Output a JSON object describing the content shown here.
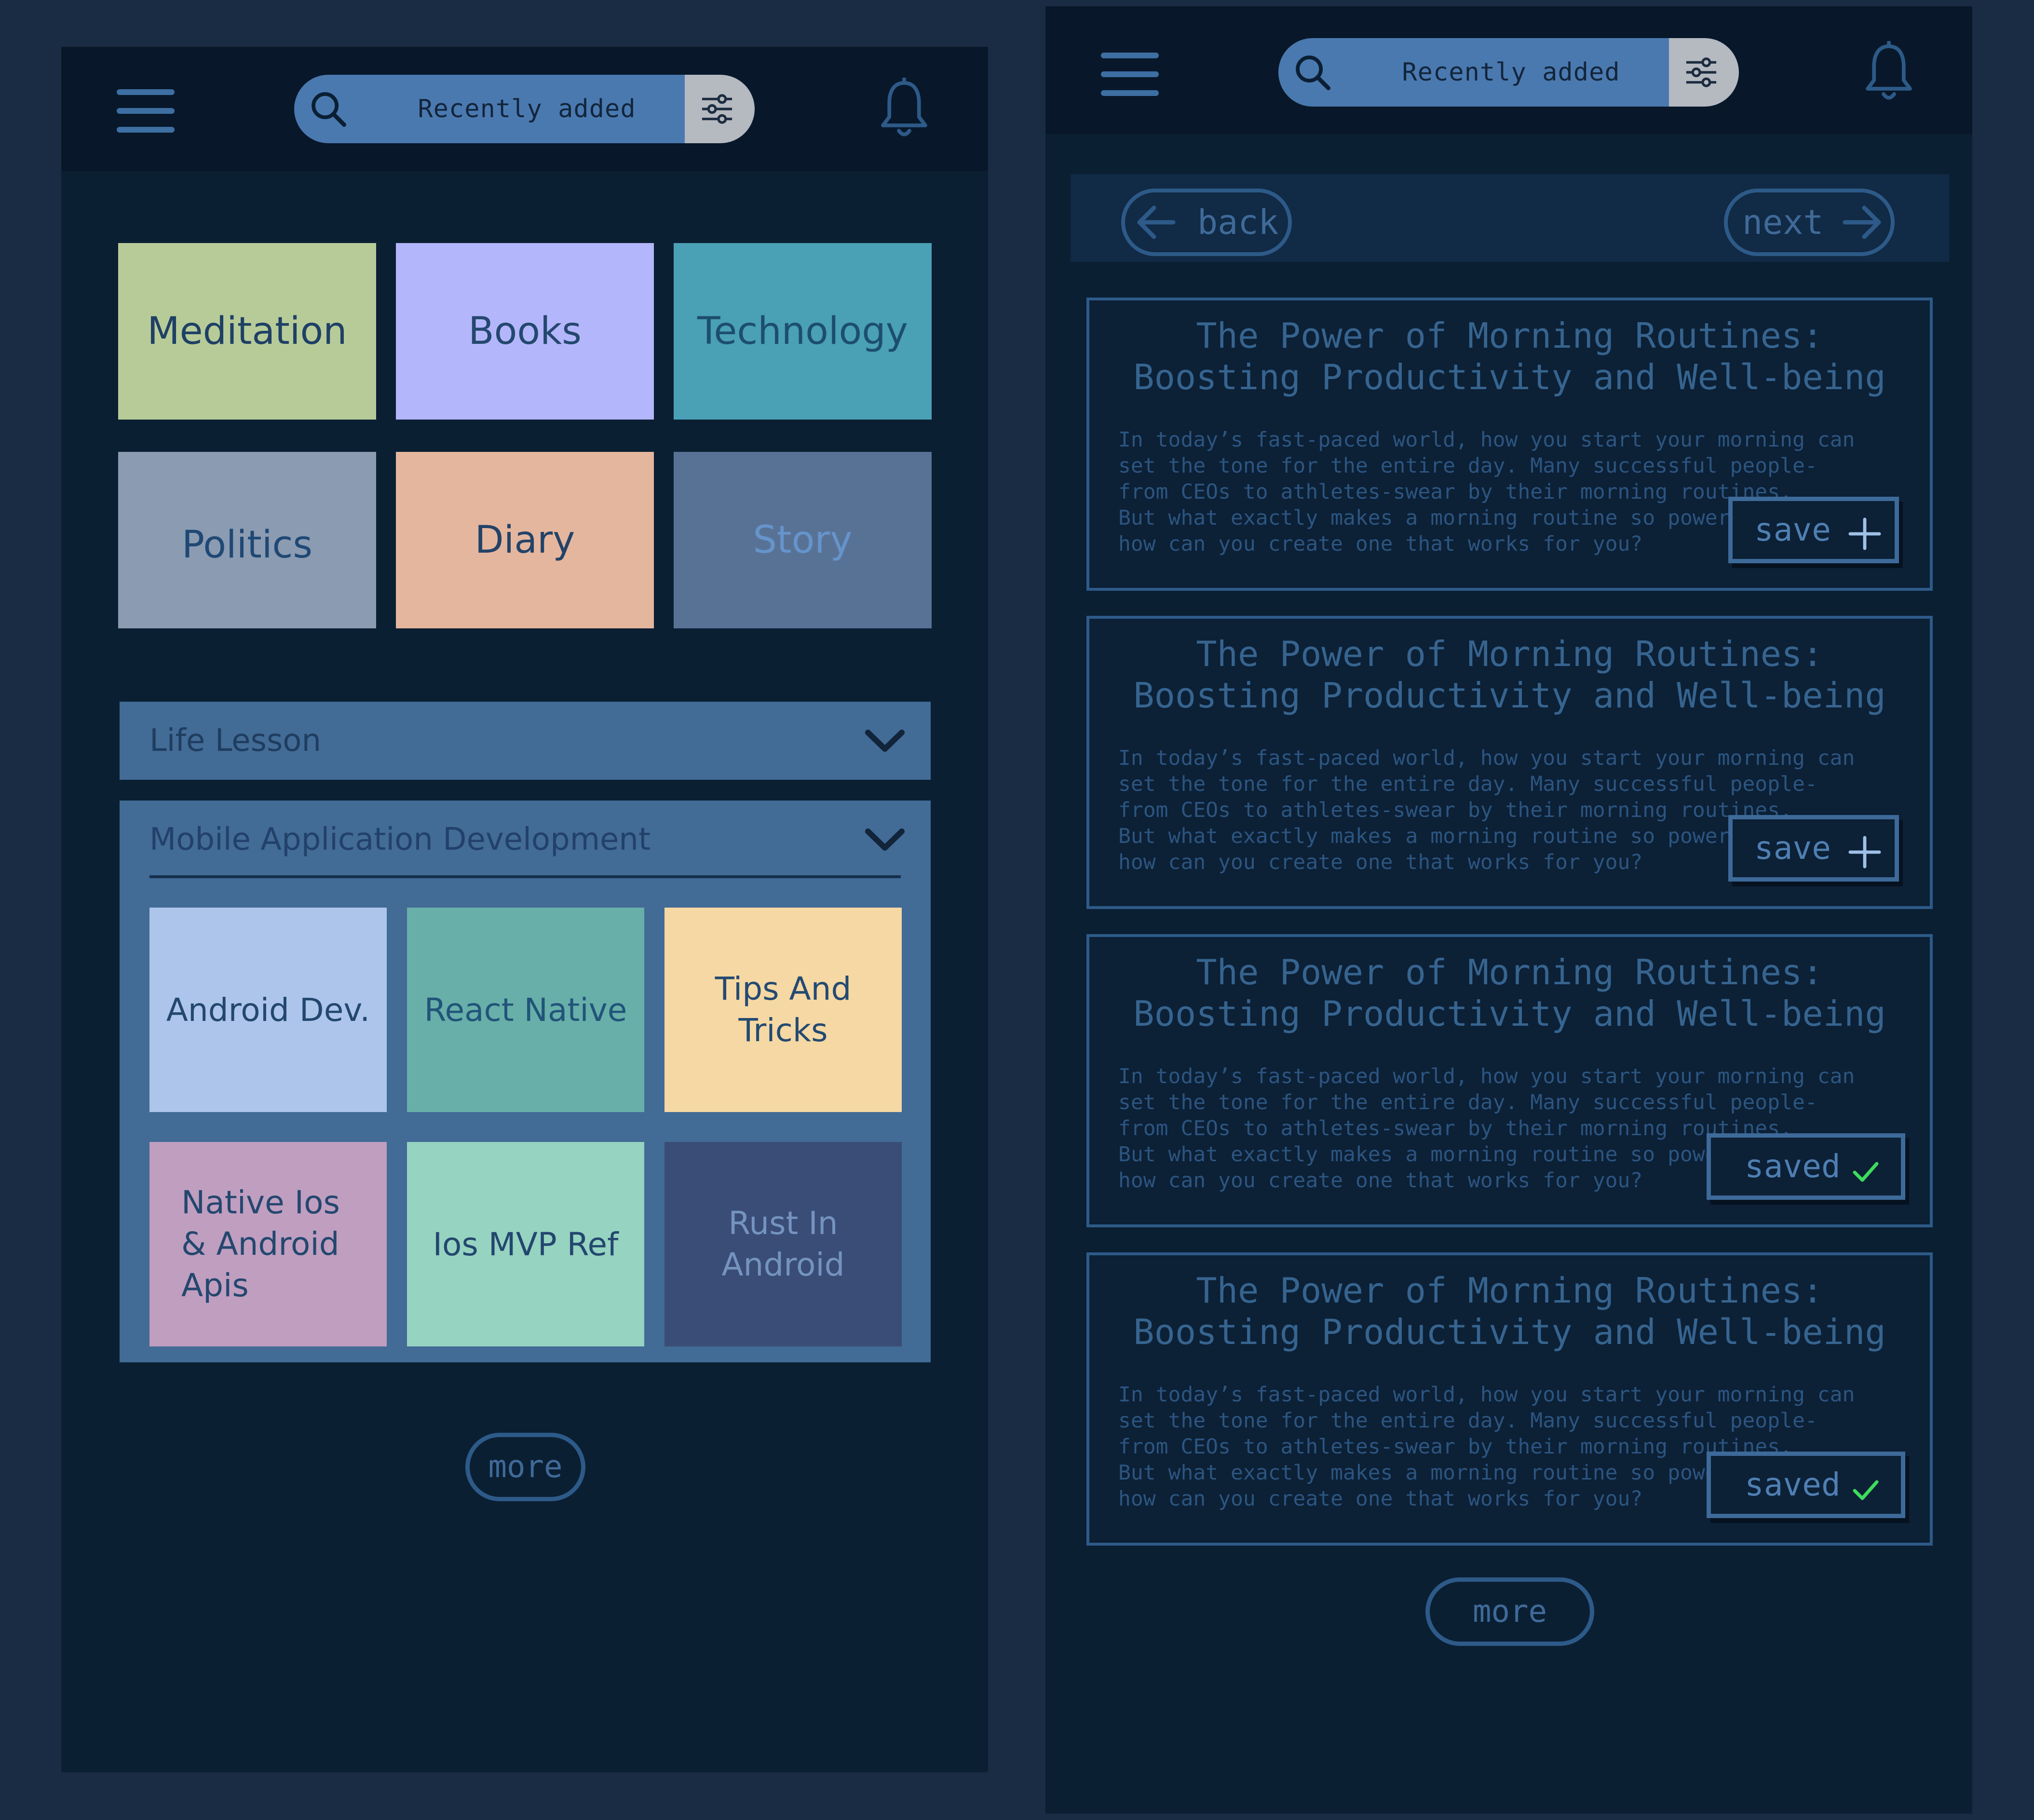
{
  "search": {
    "text": "Recently added"
  },
  "left": {
    "categories": [
      "Meditation",
      "Books",
      "Technology",
      "Politics",
      "Diary",
      "Story"
    ],
    "accordion1": {
      "title": "Life Lesson"
    },
    "accordion2": {
      "title": "Mobile Application Development",
      "items": [
        "Android Dev.",
        "React Native",
        "Tips And\nTricks",
        "Native Ios\n& Android\nApis",
        "Ios MVP Ref",
        "Rust In\nAndroid"
      ]
    },
    "more_label": "more"
  },
  "right": {
    "back_label": "back",
    "next_label": "next",
    "articles": [
      {
        "title": "The Power of Morning Routines:\nBoosting Productivity and Well-being",
        "body": "In today’s fast-paced world, how you start your morning can\nset the tone for the entire day. Many successful people-\nfrom CEOs to athletes-swear by their morning routines.\nBut what exactly makes a morning routine so powerful, and\nhow can you create one that works for you?",
        "button": "save"
      },
      {
        "title": "The Power of Morning Routines:\nBoosting Productivity and Well-being",
        "body": "In today’s fast-paced world, how you start your morning can\nset the tone for the entire day. Many successful people-\nfrom CEOs to athletes-swear by their morning routines.\nBut what exactly makes a morning routine so powerful, and\nhow can you create one that works for you?",
        "button": "save"
      },
      {
        "title": "The Power of Morning Routines:\nBoosting Productivity and Well-being",
        "body": "In today’s fast-paced world, how you start your morning can\nset the tone for the entire day. Many successful people-\nfrom CEOs to athletes-swear by their morning routines.\nBut what exactly makes a morning routine so powerful, and\nhow can you create one that works for you?",
        "button": "saved"
      },
      {
        "title": "The Power of Morning Routines:\nBoosting Productivity and Well-being",
        "body": "In today’s fast-paced world, how you start your morning can\nset the tone for the entire day. Many successful people-\nfrom CEOs to athletes-swear by their morning routines.\nBut what exactly makes a morning routine so powerful, and\nhow can you create one that works for you?",
        "button": "saved"
      }
    ],
    "more_label": "more"
  },
  "colors": {
    "background": "#1a2b44",
    "panel": "#0b1f33",
    "accent": "#4a79b0",
    "check": "#3ddc5c"
  }
}
